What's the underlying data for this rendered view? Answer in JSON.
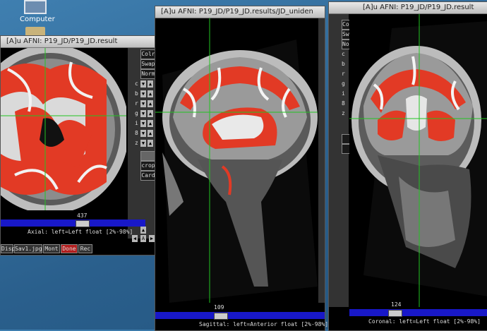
{
  "desktop": {
    "icon_label": "Computer"
  },
  "axial": {
    "title": "[A]u AFNI: P19_JD/P19_JD.result",
    "slice_number": "437",
    "status": "Axial: left=Left float [2%-98%]",
    "buttons": [
      "Colr",
      "Swap",
      "Norm"
    ],
    "letters": [
      "c",
      "b",
      "r",
      "g",
      "i",
      "8",
      "z"
    ],
    "side_extra": [
      "crop",
      "Card"
    ],
    "bottom_buttons": [
      "Disp",
      "Sav1.jpg",
      "Mont",
      "Done",
      "Rec"
    ]
  },
  "sagittal": {
    "title": "[A]u AFNI: P19_JD/P19_JD.results/JD_uniden",
    "slice_number": "109",
    "status": "Sagittal: left=Anterior float [2%-98%]"
  },
  "coronal": {
    "title": "[A]u AFNI: P19_JD/P19_JD.result",
    "slice_number": "124",
    "status": "Coronal: left=Left float [2%-98%]",
    "side_buttons": [
      "Colr",
      "Swap",
      "Norm"
    ],
    "letters": [
      "c",
      "b",
      "r",
      "g",
      "i",
      "8",
      "z"
    ]
  },
  "colors": {
    "overlay": "#e23a25",
    "crosshair": "#22c422",
    "slider": "#1818c8"
  }
}
